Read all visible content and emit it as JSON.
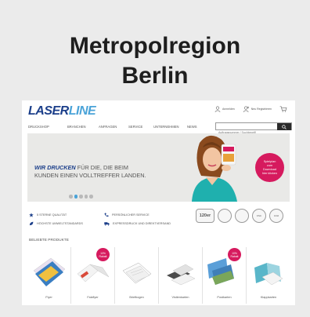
{
  "card": {
    "title_line1": "Metropolregion",
    "title_line2": "Berlin"
  },
  "logo": {
    "part1": "LASER",
    "part2": "LINE"
  },
  "header": {
    "items": [
      {
        "icon": "user-icon",
        "label": "Anmelden"
      },
      {
        "icon": "user-add-icon",
        "label": "Neu Registrieren"
      },
      {
        "icon": "cart-icon",
        "label": ""
      }
    ]
  },
  "nav": {
    "items": [
      "Druckshop",
      "Branchen",
      "Anfragen",
      "Service",
      "Unternehmen",
      "News"
    ]
  },
  "search": {
    "placeholder": "Auftragsnummer / Suchbegriff",
    "button_icon": "search-icon"
  },
  "hero": {
    "headline_bold": "WIR DRUCKEN",
    "headline_rest": " FÜR DIE, DIE BEIM",
    "line2": "KUNDEN EINEN VOLLTREFFER LANDEN.",
    "badge": [
      "Spielplan",
      "zum",
      "Download",
      "hier klicken"
    ],
    "slides": 5,
    "active_slide": 1
  },
  "trust": [
    {
      "icon": "star-icon",
      "label": "5 Sterne Qualität"
    },
    {
      "icon": "phone-icon",
      "label": "Persönlicher Service"
    },
    {
      "icon": "leaf-icon",
      "label": "Höchste Umweltstandards"
    },
    {
      "icon": "truck-icon",
      "label": "Expressdruck und Direktversand"
    }
  ],
  "seals": [
    "120er",
    "seal",
    "seal",
    "FSC",
    "CO2"
  ],
  "products": {
    "heading": "Beliebte Produkte",
    "badge": [
      "10%",
      "Rabatt"
    ],
    "items": [
      {
        "name": "Flyer",
        "badge": false
      },
      {
        "name": "Falzflyer",
        "badge": true
      },
      {
        "name": "Briefbogen",
        "badge": false
      },
      {
        "name": "Visitenkarten",
        "badge": false
      },
      {
        "name": "Postkarten",
        "badge": true
      },
      {
        "name": "Klappkarten",
        "badge": false
      }
    ]
  },
  "colors": {
    "brand_dark": "#1c3f8a",
    "brand_light": "#4aa3d8",
    "accent": "#d61a5e"
  }
}
